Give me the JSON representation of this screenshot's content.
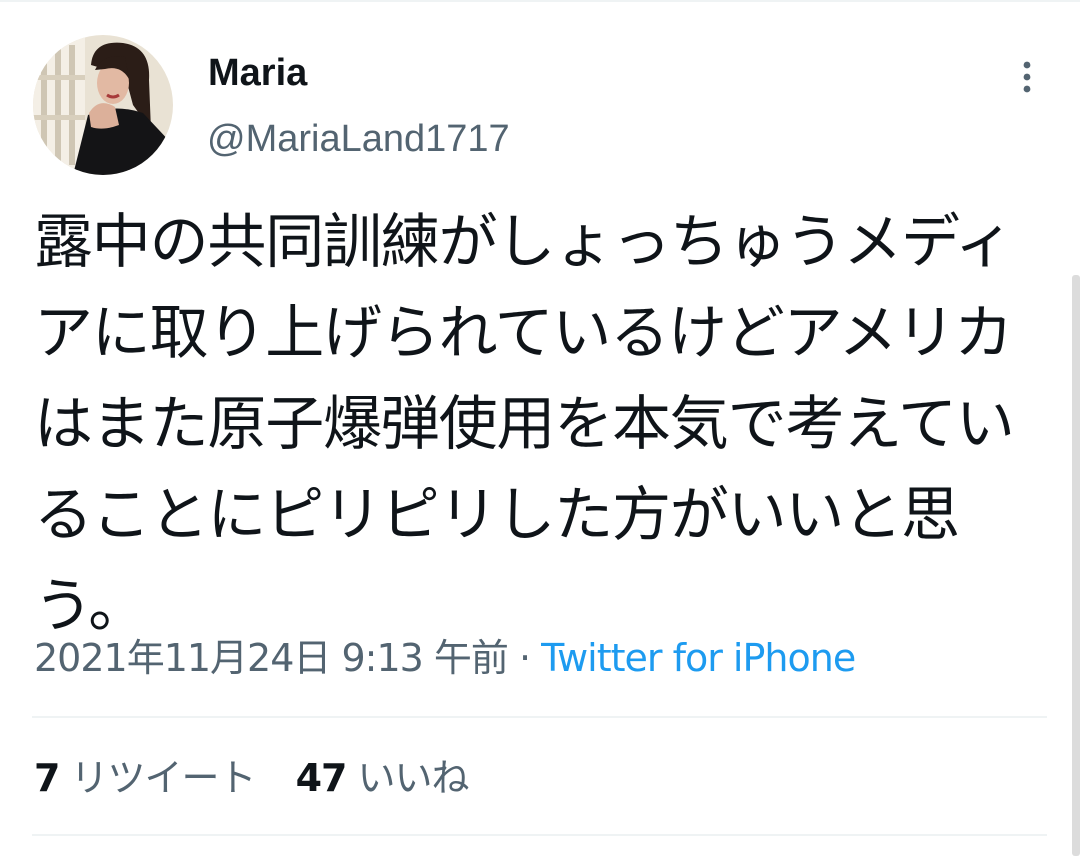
{
  "tweet": {
    "display_name": "Maria",
    "handle": "@MariaLand1717",
    "text": "露中の共同訓練がしょっちゅうメディアに取り上げられているけどアメリカはまた原子爆弾使用を本気で考えていることにピリピリした方がいいと思う。",
    "timestamp": "2021年11月24日 9:13 午前",
    "separator": " · ",
    "source": "Twitter for iPhone"
  },
  "stats": {
    "retweets_count": "7",
    "retweets_label": "リツイート",
    "likes_count": "47",
    "likes_label": "いいね"
  },
  "icons": {
    "more": "more-vertical-icon"
  },
  "colors": {
    "text_primary": "#0f1419",
    "text_secondary": "#536471",
    "link": "#1d9bf0",
    "divider": "#eff3f4"
  }
}
